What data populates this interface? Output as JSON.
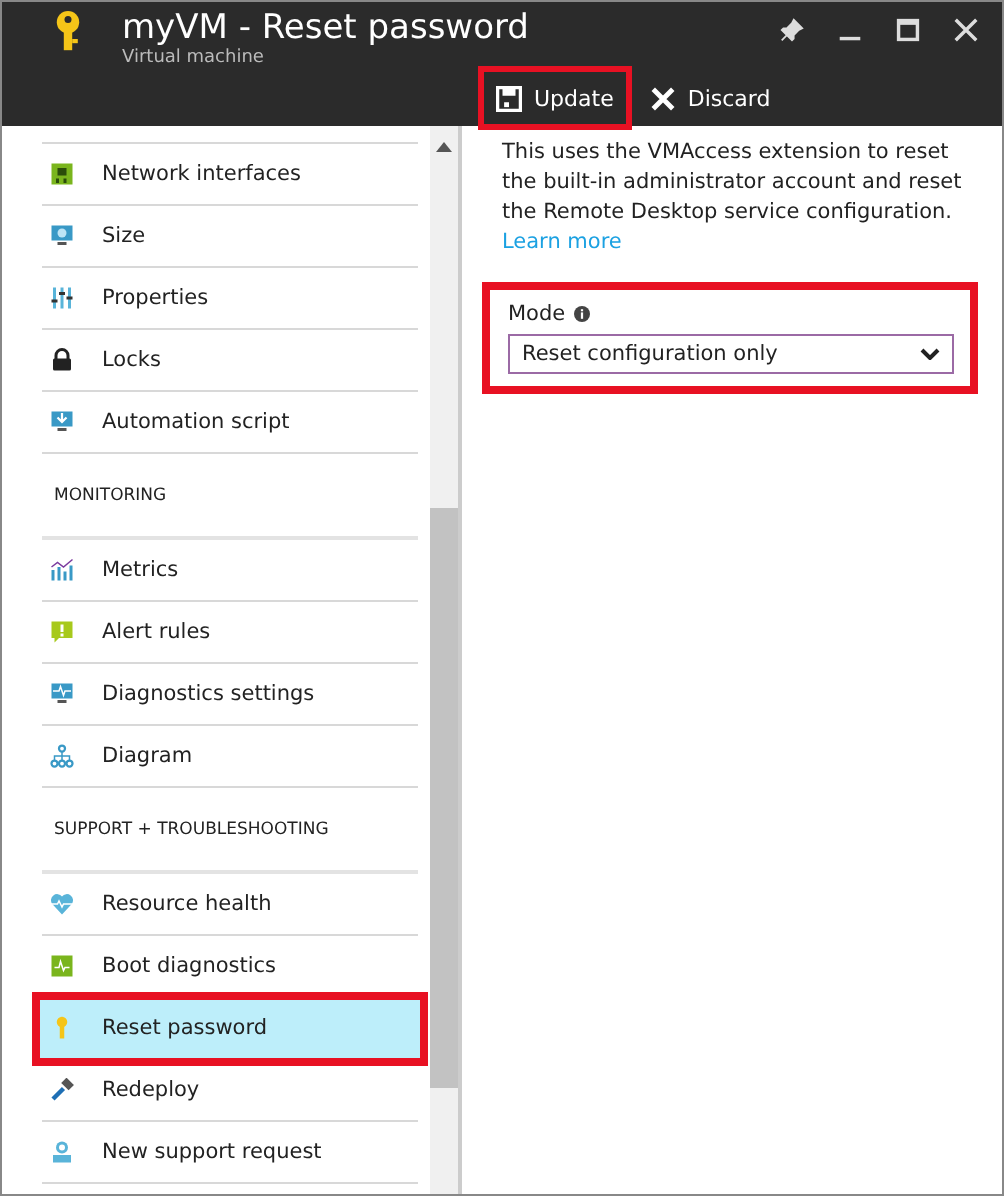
{
  "window": {
    "title": "myVM - Reset password",
    "subtitle": "Virtual machine"
  },
  "toolbar": [
    {
      "kind": "save",
      "label": "Update",
      "highlighted": true
    },
    {
      "kind": "discard",
      "label": "Discard",
      "highlighted": false
    }
  ],
  "sidebar": {
    "sections": [
      {
        "items": [
          {
            "kind": "network",
            "label": "Network interfaces",
            "selected": false,
            "highlighted": false
          },
          {
            "kind": "size",
            "label": "Size",
            "selected": false,
            "highlighted": false
          },
          {
            "kind": "properties",
            "label": "Properties",
            "selected": false,
            "highlighted": false
          },
          {
            "kind": "lock",
            "label": "Locks",
            "selected": false,
            "highlighted": false
          },
          {
            "kind": "script",
            "label": "Automation script",
            "selected": false,
            "highlighted": false
          }
        ]
      },
      {
        "heading": "MONITORING",
        "items": [
          {
            "kind": "metrics",
            "label": "Metrics",
            "selected": false,
            "highlighted": false
          },
          {
            "kind": "alert",
            "label": "Alert rules",
            "selected": false,
            "highlighted": false
          },
          {
            "kind": "diagnostics",
            "label": "Diagnostics settings",
            "selected": false,
            "highlighted": false
          },
          {
            "kind": "diagram",
            "label": "Diagram",
            "selected": false,
            "highlighted": false
          }
        ]
      },
      {
        "heading": "SUPPORT + TROUBLESHOOTING",
        "items": [
          {
            "kind": "health",
            "label": "Resource health",
            "selected": false,
            "highlighted": false
          },
          {
            "kind": "boot",
            "label": "Boot diagnostics",
            "selected": false,
            "highlighted": false
          },
          {
            "kind": "key",
            "label": "Reset password",
            "selected": true,
            "highlighted": true
          },
          {
            "kind": "redeploy",
            "label": "Redeploy",
            "selected": false,
            "highlighted": false
          },
          {
            "kind": "support",
            "label": "New support request",
            "selected": false,
            "highlighted": false
          }
        ]
      }
    ]
  },
  "content": {
    "description": "This uses the VMAccess extension to reset the built-in administrator account and reset the Remote Desktop service configuration.",
    "link": "Learn more",
    "mode": {
      "label": "Mode",
      "value": "Reset configuration only",
      "highlighted": true
    }
  }
}
